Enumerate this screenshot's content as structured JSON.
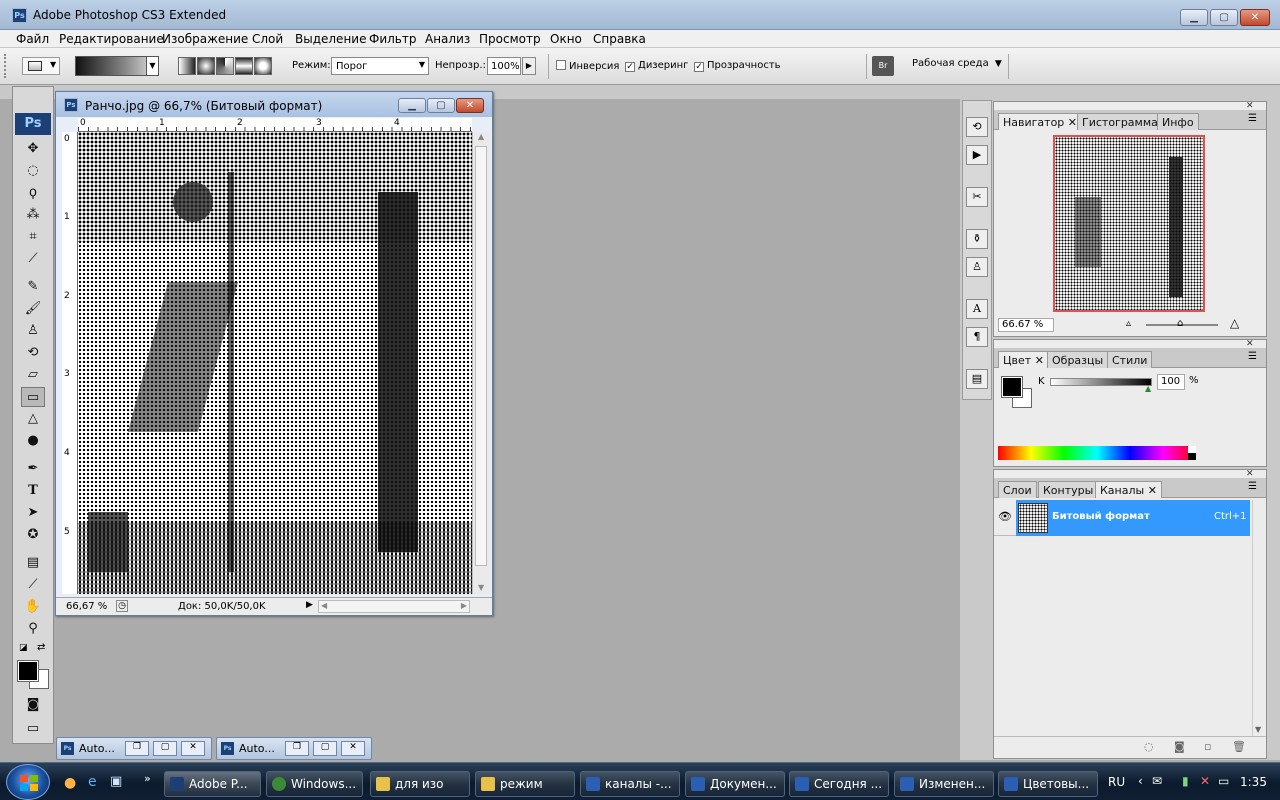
{
  "app": {
    "title": "Adobe Photoshop CS3 Extended",
    "ps_badge": "Ps"
  },
  "window_buttons": {
    "minimize": "▁",
    "maximize": "▢",
    "close": "✕"
  },
  "menu": [
    "Файл",
    "Редактирование",
    "Изображение",
    "Слой",
    "Выделение",
    "Фильтр",
    "Анализ",
    "Просмотр",
    "Окно",
    "Справка"
  ],
  "options": {
    "mode_label": "Режим:",
    "mode_value": "Порог",
    "opacity_label": "Непрозр.:",
    "opacity_value": "100%",
    "inversion_label": "Инверсия",
    "inversion_checked": false,
    "dither_label": "Дизеринг",
    "dither_checked": true,
    "transparency_label": "Прозрачность",
    "transparency_checked": true,
    "workspace_label": "Рабочая среда"
  },
  "document": {
    "title": "Ранчо.jpg @ 66,7% (Битовый формат)",
    "ruler_h": [
      "0",
      "1",
      "2",
      "3",
      "4"
    ],
    "ruler_v": [
      "0",
      "1",
      "2",
      "3",
      "4",
      "5"
    ],
    "zoom": "66,67 %",
    "doc_info": "Док: 50,0K/50,0K"
  },
  "navigator_panel": {
    "tabs": [
      "Навигатор",
      "Гистограмма",
      "Инфо"
    ],
    "active_tab": "Навигатор",
    "zoom": "66.67 %"
  },
  "color_panel": {
    "tabs": [
      "Цвет",
      "Образцы",
      "Стили"
    ],
    "active_tab": "Цвет",
    "channel_label": "K",
    "value": "100",
    "unit": "%",
    "foreground": "#000000",
    "background": "#ffffff"
  },
  "channels_panel": {
    "tabs": [
      "Слои",
      "Контуры",
      "Каналы"
    ],
    "active_tab": "Каналы",
    "rows": [
      {
        "name": "Битовый формат",
        "shortcut": "Ctrl+1",
        "selected": true,
        "visible": true
      }
    ]
  },
  "minimized_windows": [
    "Auto...",
    "Auto..."
  ],
  "taskbar": {
    "items": [
      {
        "label": "Adobe P...",
        "color": "#1c3f76"
      },
      {
        "label": "Windows...",
        "color": "#3a8a3a"
      },
      {
        "label": "для изо",
        "color": "#e8c14a"
      },
      {
        "label": "режим",
        "color": "#e8c14a"
      },
      {
        "label": "каналы -...",
        "color": "#2b5fb4"
      },
      {
        "label": "Докумен...",
        "color": "#2b5fb4"
      },
      {
        "label": "Сегодня ...",
        "color": "#2b5fb4"
      },
      {
        "label": "Изменен...",
        "color": "#2b5fb4"
      },
      {
        "label": "Цветовы...",
        "color": "#2b5fb4"
      }
    ],
    "language": "RU",
    "clock": "1:35"
  },
  "colors": {
    "accent": "#3399ff",
    "titlebar": "#a9c1e1",
    "workspace": "#ababab"
  }
}
